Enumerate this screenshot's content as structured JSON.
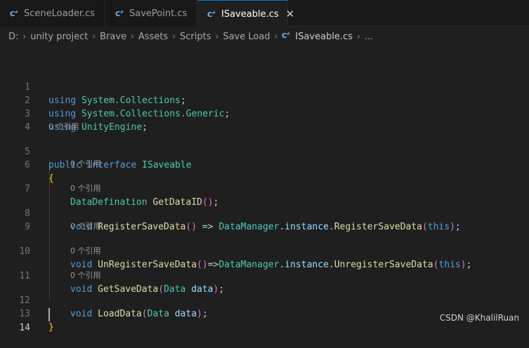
{
  "tabs": [
    {
      "label": "SceneLoader.cs",
      "active": false
    },
    {
      "label": "SavePoint.cs",
      "active": false
    },
    {
      "label": "ISaveable.cs",
      "active": true
    }
  ],
  "tab_close_glyph": "✕",
  "breadcrumb": [
    "D:",
    "unity project",
    "Brave",
    "Assets",
    "Scripts",
    "Save Load",
    "ISaveable.cs",
    "..."
  ],
  "breadcrumb_separator": "›",
  "code_lens": {
    "ref_text": "0 个引用"
  },
  "line_numbers": [
    "1",
    "2",
    "3",
    "4",
    "5",
    "6",
    "7",
    "8",
    "9",
    "10",
    "11",
    "12",
    "13",
    "14"
  ],
  "code": {
    "l1": [
      "using",
      " ",
      "System.Collections",
      ";"
    ],
    "l2": [
      "using",
      " ",
      "System.Collections.Generic",
      ";"
    ],
    "l3": [
      "using",
      " ",
      "UnityEngine",
      ";"
    ],
    "l5": [
      "public",
      " ",
      "interface",
      " ",
      "ISaveable"
    ],
    "l6": [
      "{"
    ],
    "l7": [
      "DataDefination",
      " ",
      "GetDataID",
      "(",
      ")",
      ";"
    ],
    "l8": [
      "void",
      " ",
      "RegisterSaveData",
      "(",
      ")",
      " => ",
      "DataManager",
      ".",
      "instance",
      ".",
      "RegisterSaveData",
      "(",
      "this",
      ")",
      ";"
    ],
    "l10": [
      "void",
      " ",
      "UnRegisterSaveData",
      "(",
      ")",
      "=>",
      "DataManager",
      ".",
      "instance",
      ".",
      "UnregisterSaveData",
      "(",
      "this",
      ")",
      ";"
    ],
    "l11": [
      "void",
      " ",
      "GetSaveData",
      "(",
      "Data",
      " ",
      "data",
      ")",
      ";"
    ],
    "l12": [
      "void",
      " ",
      "LoadData",
      "(",
      "Data",
      " ",
      "data",
      ")",
      ";"
    ],
    "l13": [
      "}"
    ]
  },
  "watermark": "CSDN @KhalilRuan",
  "colors": {
    "background": "#1f1f1f",
    "keyword": "#569cd6",
    "type": "#4ec9b0",
    "function": "#dcdcaa",
    "variable": "#9cdcfe",
    "bracket_outer": "#ffd700",
    "bracket_inner": "#da70d6",
    "active_tab_accent": "#0078d4"
  }
}
